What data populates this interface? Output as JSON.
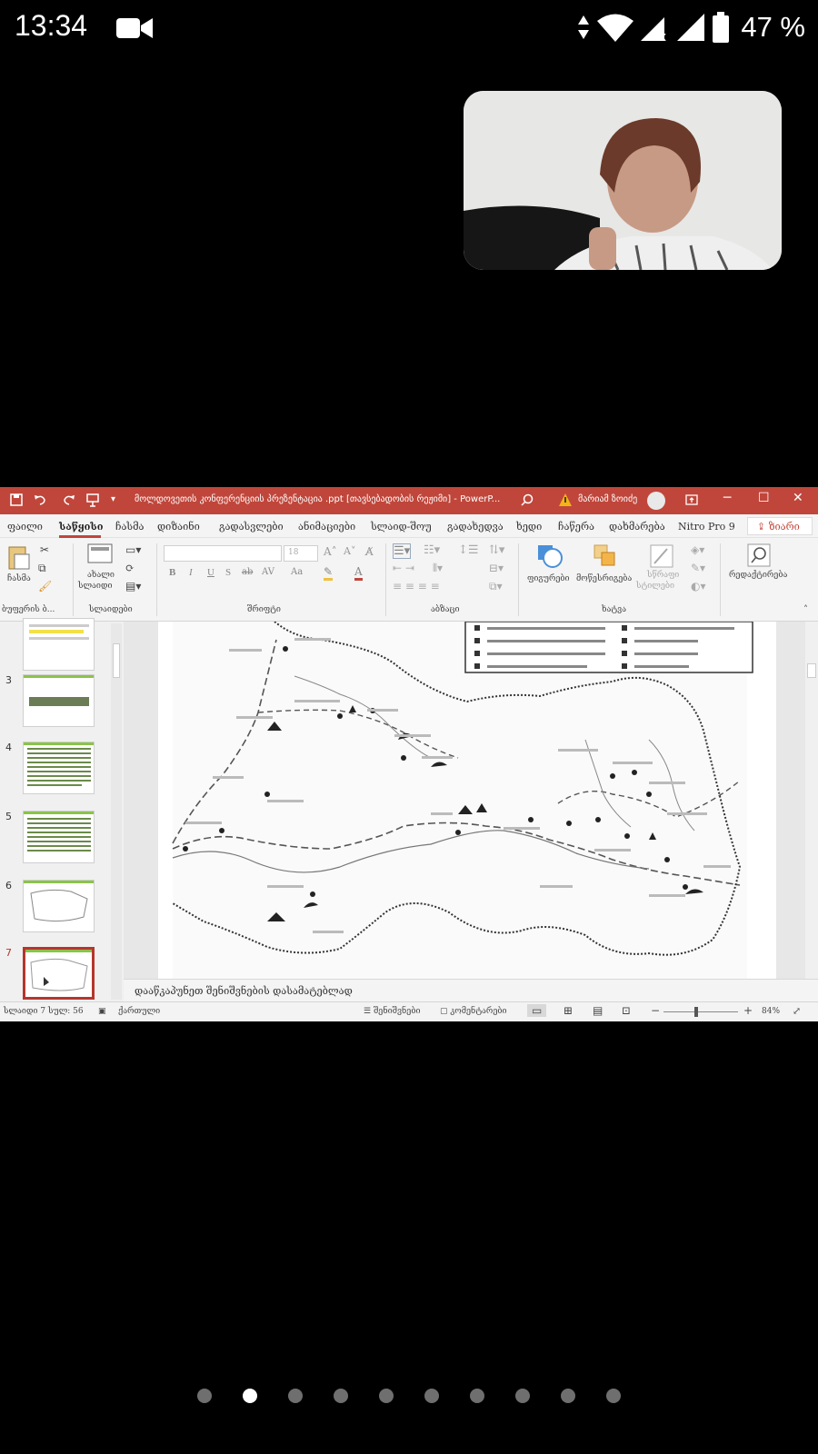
{
  "status_bar": {
    "time": "13:34",
    "battery_percent": "47 %",
    "icons": [
      "video-camera-icon",
      "data-arrows-icon",
      "wifi-icon",
      "signal-no-data-icon",
      "signal-icon",
      "battery-icon"
    ]
  },
  "ppt": {
    "title": "მოლდოვეთის კონფერენციის პრეზენტაცია .ppt [თავსებადობის რეჟიმი]  -  PowerP...",
    "user_name": "მარიამ ზოიძე",
    "tabs": [
      "ფაილი",
      "საწყისი",
      "ჩასმა",
      "დიზაინი",
      "გადასვლები",
      "ანიმაციები",
      "სლაიდ-შოუ",
      "გადახედვა",
      "ხედი",
      "ჩაწერა",
      "დახმარება",
      "Nitro Pro 9"
    ],
    "active_tab": "საწყისი",
    "share_label": "ზიარი",
    "ribbon": {
      "paste": "ჩასმა",
      "new_slide_line1": "ახალი",
      "new_slide_line2": "სლაიდი",
      "font_size": "18",
      "shapes": "ფიგურები",
      "arrange": "მოწესრიგება",
      "quick_styles_line1": "სწრაფი",
      "quick_styles_line2": "სტილები",
      "editing": "რედაქტირება",
      "groups": {
        "clipboard": "ბუფერის ბ...",
        "slides": "სლაიდები",
        "font": "შრიფტი",
        "paragraph": "აბზაცი",
        "drawing": "ხატვა"
      },
      "format_buttons": [
        "B",
        "I",
        "U",
        "S",
        "ab",
        "AV",
        "Aa"
      ]
    },
    "thumbnails": [
      {
        "num": "3"
      },
      {
        "num": "4"
      },
      {
        "num": "5"
      },
      {
        "num": "6"
      },
      {
        "num": "7",
        "selected": true
      }
    ],
    "notes_placeholder": "დააწკაპუნეთ შენიშვნების დასამატებლად",
    "statusbar": {
      "slide_info": "სლაიდი 7 სულ: 56",
      "language": "ქართული",
      "notes": "შენიშვნები",
      "comments": "კომენტარები",
      "zoom": "84%"
    }
  },
  "colors": {
    "title_bar": "#c0463b",
    "ribbon_bg": "#f4f4f4",
    "selected_thumb": "#b5362c"
  },
  "pager": {
    "count": 10,
    "active": 1
  }
}
